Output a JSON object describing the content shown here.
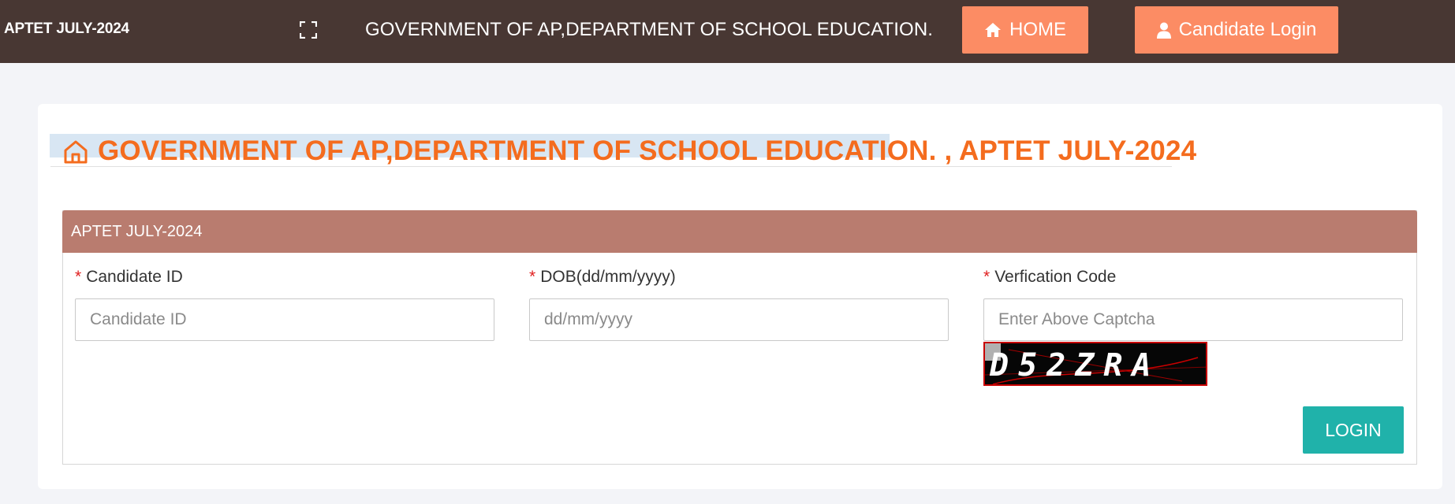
{
  "header": {
    "brand": "APTET JULY-2024",
    "title": "GOVERNMENT OF AP,DEPARTMENT OF SCHOOL EDUCATION.",
    "home_label": "HOME",
    "candidate_login_label": "Candidate Login"
  },
  "page": {
    "heading": "GOVERNMENT OF AP,DEPARTMENT OF SCHOOL EDUCATION. , APTET JULY-2024"
  },
  "form": {
    "panel_title": "APTET JULY-2024",
    "required_mark": "*",
    "candidate_id": {
      "label": "Candidate ID",
      "placeholder": "Candidate ID",
      "value": ""
    },
    "dob": {
      "label": "DOB(dd/mm/yyyy)",
      "placeholder": "dd/mm/yyyy",
      "value": ""
    },
    "verification": {
      "label": "Verfication Code",
      "placeholder": "Enter Above Captcha",
      "value": ""
    },
    "captcha_text": "D52ZRA",
    "login_label": "LOGIN"
  },
  "icons": {
    "expand": "fullscreen-icon",
    "home": "home-icon",
    "user": "user-icon",
    "heading": "home-outline-icon"
  },
  "colors": {
    "topbar": "#483733",
    "accent_button": "#fc8c64",
    "heading": "#f46c1e",
    "panel_header": "#b97c6f",
    "login_button": "#20b2aa",
    "required": "#e02020"
  }
}
